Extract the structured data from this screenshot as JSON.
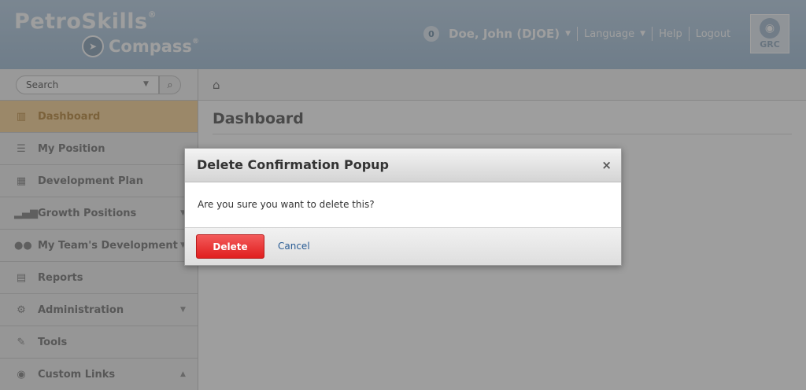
{
  "header": {
    "brand": "PetroSkills",
    "brand_mark": "®",
    "product": "Compass",
    "product_mark": "®",
    "notification_count": "0",
    "user_name": "Doe, John (DJOE)",
    "language_label": "Language",
    "help_label": "Help",
    "logout_label": "Logout",
    "grc_label": "GRC"
  },
  "search": {
    "placeholder": "Search"
  },
  "sidebar": {
    "items": [
      {
        "label": "Dashboard",
        "icon": "bar-chart-icon",
        "active": true
      },
      {
        "label": "My Position",
        "icon": "list-icon"
      },
      {
        "label": "Development Plan",
        "icon": "calendar-icon"
      },
      {
        "label": "Growth Positions",
        "icon": "signal-icon",
        "has_caret": true
      },
      {
        "label": "My Team's Development",
        "icon": "group-icon",
        "has_caret": true
      },
      {
        "label": "Reports",
        "icon": "print-icon"
      },
      {
        "label": "Administration",
        "icon": "gears-icon",
        "has_caret": true
      },
      {
        "label": "Tools",
        "icon": "wrench-icon"
      },
      {
        "label": "Custom Links",
        "icon": "globe-icon",
        "has_caret": true
      }
    ]
  },
  "main": {
    "title": "Dashboard"
  },
  "modal": {
    "title": "Delete Confirmation Popup",
    "close_symbol": "×",
    "message": "Are you sure you want to delete this?",
    "delete_label": "Delete",
    "cancel_label": "Cancel"
  },
  "colors": {
    "header_bg": "#b8cde0",
    "active_nav_bg": "#fbdcaa",
    "delete_button": "#e53a3a",
    "link": "#2a5d95"
  }
}
